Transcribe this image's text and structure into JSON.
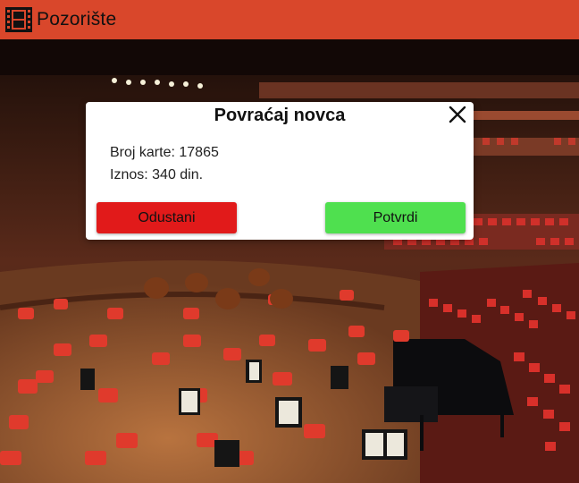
{
  "app": {
    "title": "Pozorište",
    "icon": "film-strip-icon",
    "header_color": "#d9472b"
  },
  "background": {
    "description_icon": "concert-hall-image"
  },
  "dialog": {
    "title": "Povraćaj novca",
    "close_icon": "close-icon",
    "ticket_label": "Broj karte:",
    "ticket_number": "17865",
    "amount_label": "Iznos:",
    "amount_value": "340 din.",
    "cancel_label": "Odustani",
    "confirm_label": "Potvrdi",
    "cancel_color": "#e11a1a",
    "confirm_color": "#4fe04f"
  }
}
